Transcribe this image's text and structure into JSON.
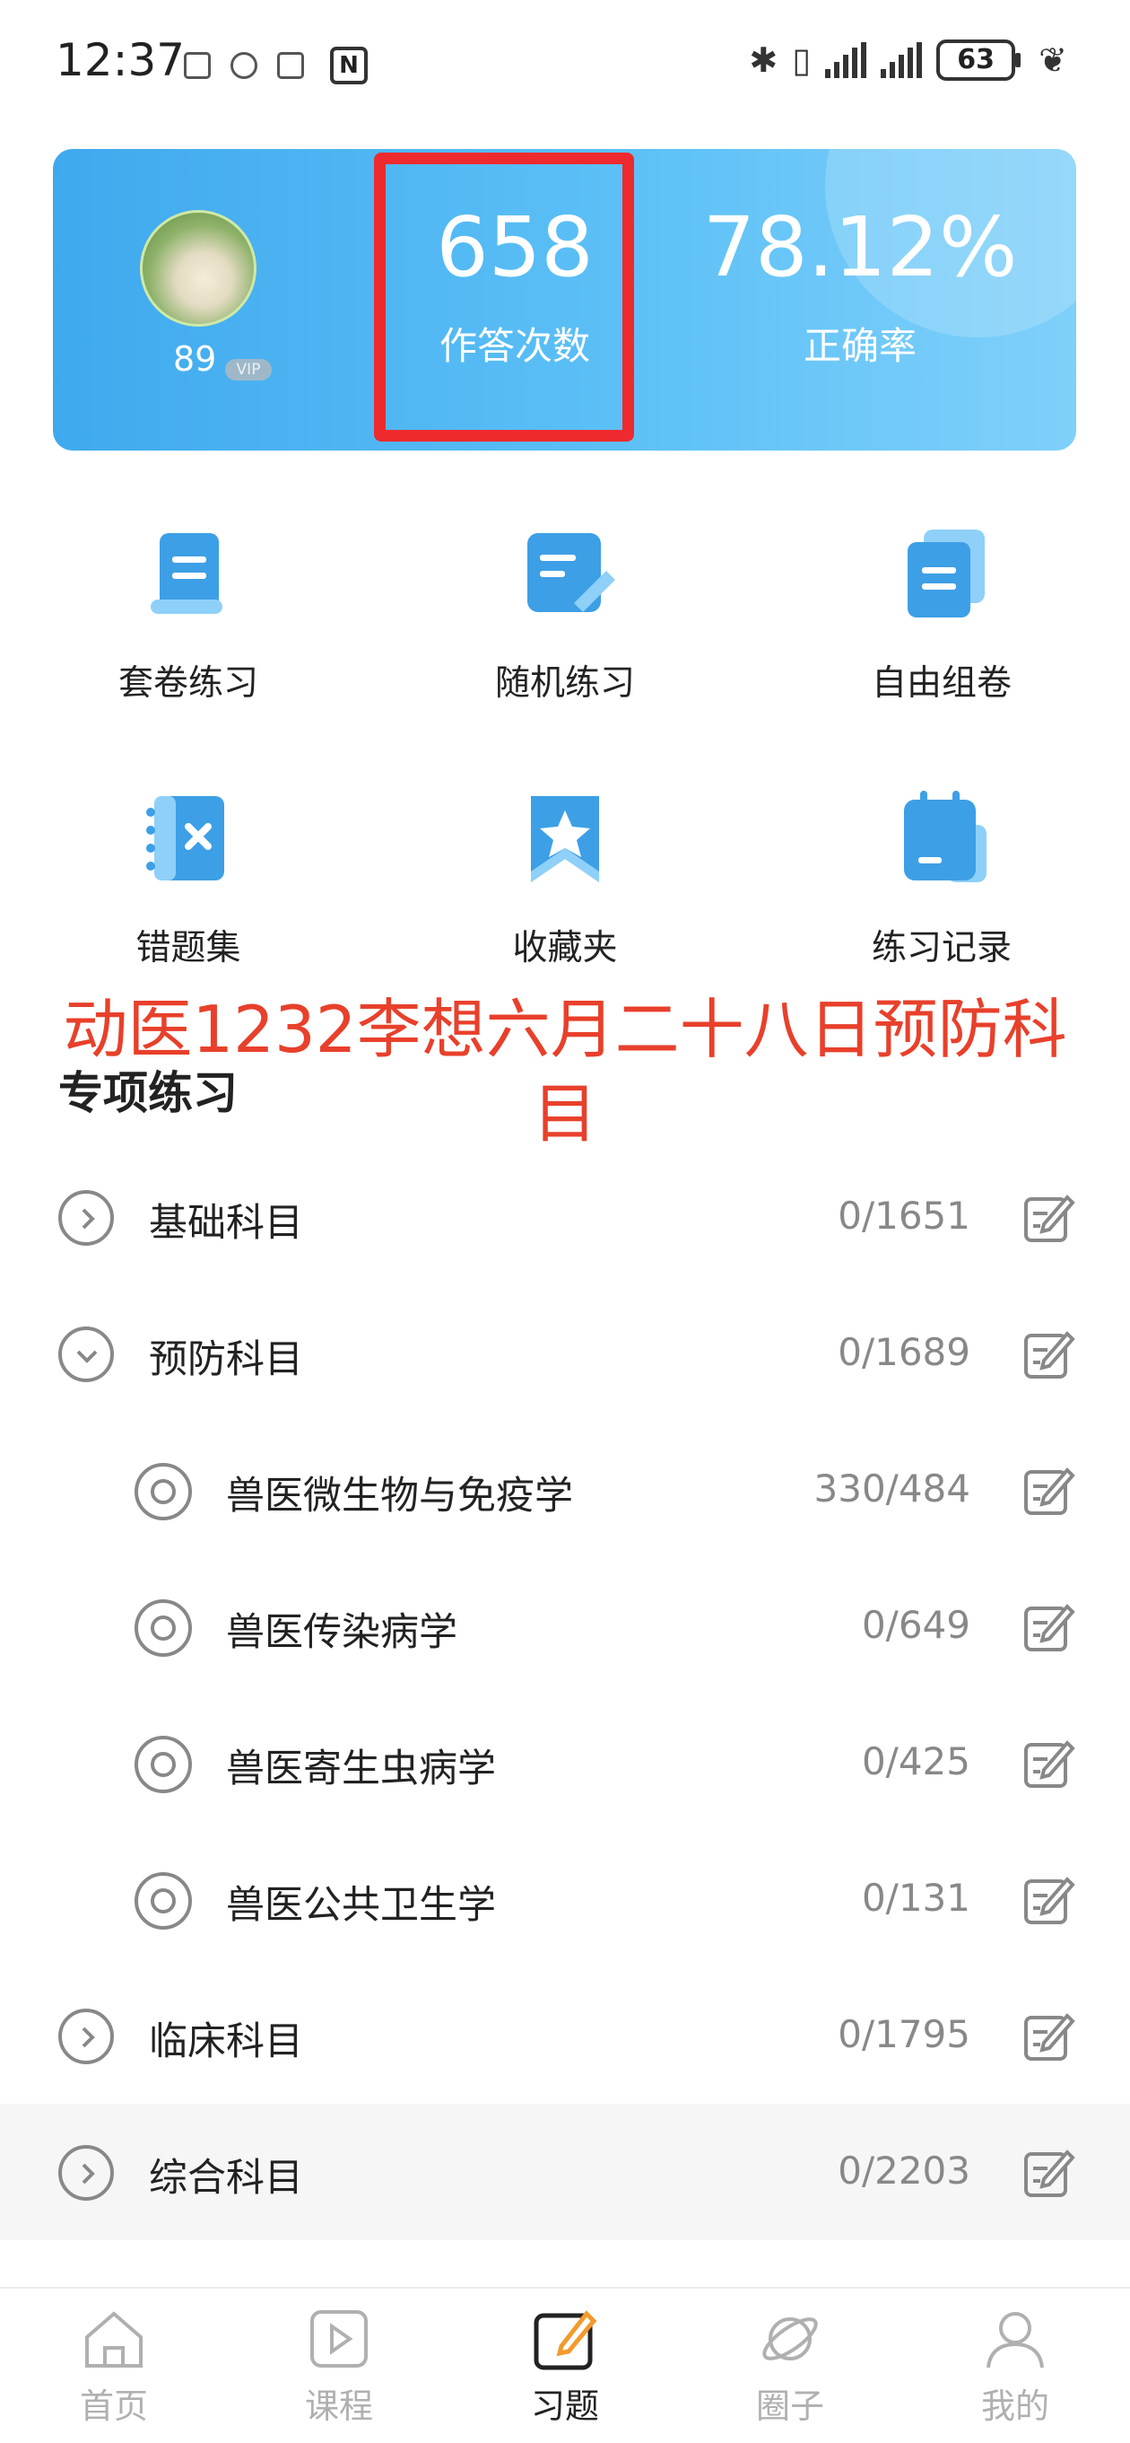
{
  "status_bar": {
    "time": "12:37",
    "nfc": "N",
    "battery": "63"
  },
  "profile": {
    "level": "89",
    "vip": "VIP"
  },
  "stats": [
    {
      "value": "658",
      "label": "作答次数"
    },
    {
      "value": "78.12%",
      "label": "正确率"
    }
  ],
  "grid": [
    {
      "label": "套卷练习",
      "icon": "paper-scroll-icon"
    },
    {
      "label": "随机练习",
      "icon": "edit-document-icon"
    },
    {
      "label": "自由组卷",
      "icon": "stacked-papers-icon"
    },
    {
      "label": "错题集",
      "icon": "wrong-notebook-icon"
    },
    {
      "label": "收藏夹",
      "icon": "star-bookmark-icon"
    },
    {
      "label": "练习记录",
      "icon": "calendar-record-icon"
    }
  ],
  "overlay_text": "动医1232李想六月二十八日预防科目",
  "section_title": "专项练习",
  "subjects": [
    {
      "name": "基础科目",
      "count": "0/1651",
      "expanded": false,
      "level": 0
    },
    {
      "name": "预防科目",
      "count": "0/1689",
      "expanded": true,
      "level": 0
    },
    {
      "name": "兽医微生物与免疫学",
      "count": "330/484",
      "level": 1
    },
    {
      "name": "兽医传染病学",
      "count": "0/649",
      "level": 1
    },
    {
      "name": "兽医寄生虫病学",
      "count": "0/425",
      "level": 1
    },
    {
      "name": "兽医公共卫生学",
      "count": "0/131",
      "level": 1
    },
    {
      "name": "临床科目",
      "count": "0/1795",
      "expanded": false,
      "level": 0
    },
    {
      "name": "综合科目",
      "count": "0/2203",
      "expanded": false,
      "level": 0
    }
  ],
  "bottom_nav": [
    {
      "label": "首页",
      "icon": "home-icon",
      "active": false
    },
    {
      "label": "课程",
      "icon": "play-icon",
      "active": false
    },
    {
      "label": "习题",
      "icon": "edit-icon",
      "active": true
    },
    {
      "label": "圈子",
      "icon": "planet-icon",
      "active": false
    },
    {
      "label": "我的",
      "icon": "user-icon",
      "active": false
    }
  ],
  "colors": {
    "accent": "#4ab2f0",
    "highlight_box": "#ee2a2e",
    "overlay_text": "#e8402b",
    "active_nav_pen": "#f39a2c"
  }
}
